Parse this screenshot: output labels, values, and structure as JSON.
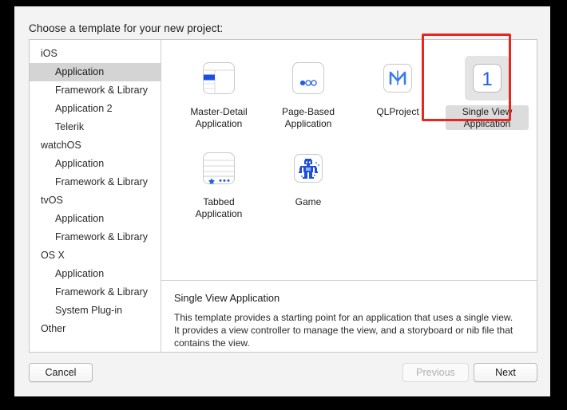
{
  "dialog": {
    "title": "Choose a template for your new project:"
  },
  "sidebar": {
    "items": [
      {
        "label": "iOS",
        "type": "group",
        "selected": false
      },
      {
        "label": "Application",
        "type": "child",
        "selected": true
      },
      {
        "label": "Framework & Library",
        "type": "child",
        "selected": false
      },
      {
        "label": "Application 2",
        "type": "child",
        "selected": false
      },
      {
        "label": "Telerik",
        "type": "child",
        "selected": false
      },
      {
        "label": "watchOS",
        "type": "group",
        "selected": false
      },
      {
        "label": "Application",
        "type": "child",
        "selected": false
      },
      {
        "label": "Framework & Library",
        "type": "child",
        "selected": false
      },
      {
        "label": "tvOS",
        "type": "group",
        "selected": false
      },
      {
        "label": "Application",
        "type": "child",
        "selected": false
      },
      {
        "label": "Framework & Library",
        "type": "child",
        "selected": false
      },
      {
        "label": "OS X",
        "type": "group",
        "selected": false
      },
      {
        "label": "Application",
        "type": "child",
        "selected": false
      },
      {
        "label": "Framework & Library",
        "type": "child",
        "selected": false
      },
      {
        "label": "System Plug-in",
        "type": "child",
        "selected": false
      },
      {
        "label": "Other",
        "type": "group",
        "selected": false
      }
    ]
  },
  "templates": {
    "row1": [
      {
        "label": "Master-Detail\nApplication",
        "icon": "master-detail-icon",
        "selected": false
      },
      {
        "label": "Page-Based\nApplication",
        "icon": "page-based-icon",
        "selected": false
      },
      {
        "label": "QLProject",
        "icon": "qlproject-icon",
        "selected": false
      },
      {
        "label": "Single View\nApplication",
        "icon": "single-view-icon",
        "selected": true
      }
    ],
    "row2": [
      {
        "label": "Tabbed\nApplication",
        "icon": "tabbed-icon",
        "selected": false
      },
      {
        "label": "Game",
        "icon": "game-icon",
        "selected": false
      }
    ]
  },
  "description": {
    "title": "Single View Application",
    "body": "This template provides a starting point for an application that uses a single view. It provides a view controller to manage the view, and a storyboard or nib file that contains the view."
  },
  "footer": {
    "cancel_label": "Cancel",
    "previous_label": "Previous",
    "next_label": "Next"
  },
  "colors": {
    "accent_blue": "#2360dd",
    "highlight_red": "#e8251f",
    "selection_gray": "#d4d4d4"
  }
}
